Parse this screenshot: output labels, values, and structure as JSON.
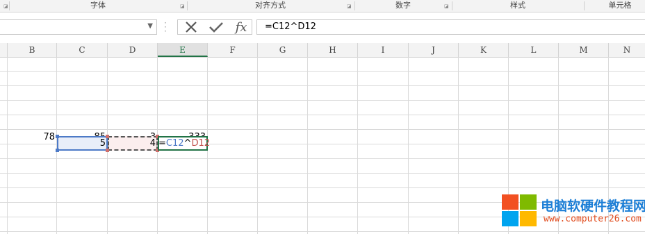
{
  "ribbon": {
    "groups": [
      "字体",
      "对齐方式",
      "数字",
      "样式",
      "单元格"
    ],
    "launcher_glyph": "◪"
  },
  "formula_bar": {
    "name_box_value": "",
    "cancel_glyph": "✕",
    "enter_glyph": "✔",
    "insert_function_label": "fx",
    "formula": "=C12^D12"
  },
  "columns": [
    "B",
    "C",
    "D",
    "E",
    "F",
    "G",
    "H",
    "I",
    "J",
    "K",
    "L",
    "M",
    "N"
  ],
  "active_column": "E",
  "cells": {
    "B9": "78",
    "C9": "85",
    "D9": "3",
    "E9": "333",
    "C12": "5",
    "D12": "4"
  },
  "edit": {
    "prefix": "=",
    "ref1": "C12",
    "op": "^",
    "ref2": "D12"
  },
  "colors": {
    "ref1": "#4d7ac7",
    "ref2": "#c0504d",
    "active": "#217346"
  },
  "watermark": {
    "title": "电脑软硬件教程网",
    "url": "www.computer26.com"
  }
}
